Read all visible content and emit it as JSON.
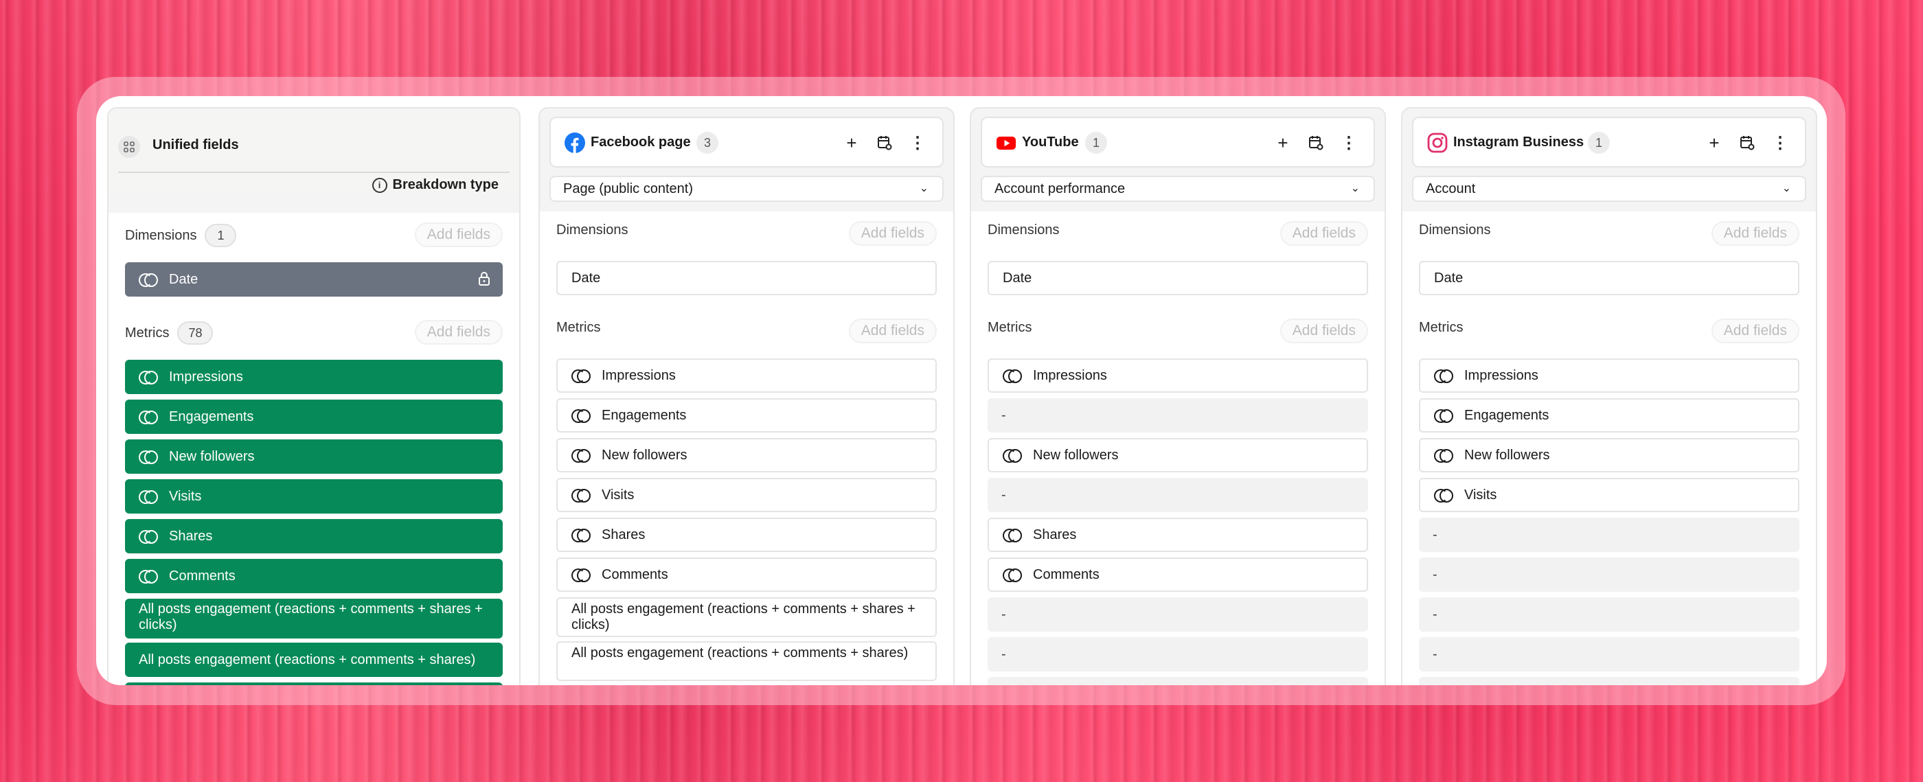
{
  "unified": {
    "title": "Unified fields",
    "breakdown_label": "Breakdown type",
    "dimensions_label": "Dimensions",
    "dimensions_count": "1",
    "metrics_label": "Metrics",
    "metrics_count": "78",
    "add_fields": "Add fields",
    "date": "Date",
    "metrics": [
      "Impressions",
      "Engagements",
      "New followers",
      "Visits",
      "Shares",
      "Comments",
      "All posts engagement (reactions + comments + shares + clicks)",
      "All posts engagement (reactions + comments + shares)"
    ]
  },
  "sources": [
    {
      "name": "Facebook page",
      "count": "3",
      "select": "Page (public content)",
      "dimensions_label": "Dimensions",
      "metrics_label": "Metrics",
      "add_fields": "Add fields",
      "date": "Date",
      "metrics": [
        "Impressions",
        "Engagements",
        "New followers",
        "Visits",
        "Shares",
        "Comments",
        "All posts engagement (reactions + comments + shares + clicks)",
        "All posts engagement (reactions + comments + shares)"
      ]
    },
    {
      "name": "YouTube",
      "count": "1",
      "select": "Account performance",
      "dimensions_label": "Dimensions",
      "metrics_label": "Metrics",
      "add_fields": "Add fields",
      "date": "Date",
      "metrics": [
        "Impressions",
        "-",
        "New followers",
        "-",
        "Shares",
        "Comments",
        "-",
        "-"
      ]
    },
    {
      "name": "Instagram Business",
      "count": "1",
      "select": "Account",
      "dimensions_label": "Dimensions",
      "metrics_label": "Metrics",
      "add_fields": "Add fields",
      "date": "Date",
      "metrics": [
        "Impressions",
        "Engagements",
        "New followers",
        "Visits",
        "-",
        "-",
        "-",
        "-"
      ]
    }
  ],
  "icons": {
    "grid": "grid-icon",
    "info": "info-icon",
    "lock": "lock-icon",
    "field": "field-link-icon",
    "facebook": "facebook-icon",
    "youtube": "youtube-icon",
    "instagram": "instagram-icon",
    "plus": "plus-icon",
    "calendar": "calendar-settings-icon",
    "more": "more-icon",
    "chevron": "chevron-down-icon"
  },
  "colors": {
    "background": "#fb3a63",
    "dimension_unified": "#6b7280",
    "metric_unified": "#078a5a",
    "facebook": "#1877f2",
    "youtube": "#ff0000",
    "instagram": "#e1306c"
  }
}
